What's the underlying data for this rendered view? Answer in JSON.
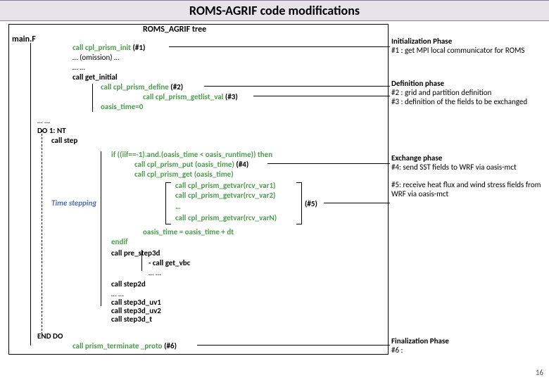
{
  "title": "ROMS-AGRIF code modifications",
  "tree_title": "ROMS_AGRIF tree",
  "mainF": "main.F",
  "code": {
    "init1": "call cpl_prism_init",
    "init1_tag": "(#1)",
    "omission": "… (omission) …",
    "dots1": "… …",
    "get_initial": "call get_initial",
    "define": "call cpl_prism_define",
    "define_tag": "(#2)",
    "getlist": "call cpl_prism_getlist_val",
    "getlist_tag": "(#3)",
    "oasis0": "oasis_time=0",
    "dots2": "… …",
    "do": "DO 1: NT",
    "call_step": "call step",
    "if": "if ((iif==-1).and.(oasis_time < oasis_runtime)) then",
    "put": "call cpl_prism_put (oasis_time)",
    "put_tag": "(#4)",
    "get": "call cpl_prism_get (oasis_time)",
    "getvar1": "call cpl_prism_getvar(rcv_var1)",
    "getvar2": "call cpl_prism_getvar(rcv_var2)",
    "getvar_dots": "…",
    "getvarN": "call cpl_prism_getvar(rcv_varN)",
    "getvar_tag": "(#5)",
    "oasis_dt": "oasis_time = oasis_time + dt",
    "endif": "endif",
    "pre_step3d": "call pre_step3d",
    "get_vbc": "- call get_vbc",
    "dots3": "… …",
    "step2d": "call step2d",
    "dots4": "… …",
    "step3d_uv1": "call step3d_uv1",
    "step3d_uv2": "call step3d_uv2",
    "step3d_t": "call step3d_t",
    "end_do": "END DO",
    "terminate": "call prism_terminate _proto",
    "terminate_tag": "(#6)",
    "time_stepping": "Time stepping"
  },
  "right": {
    "init_title": "Initialization Phase",
    "init_text": "#1 : get MPI local communicator for ROMS",
    "def_title": "Definition phase",
    "def_text1": "#2 : grid and partition definition",
    "def_text2": "#3 : definition of the fields to be exchanged",
    "ex_title": "Exchange phase",
    "ex_text1": "#4: send SST fields to WRF via oasis-mct",
    "ex_text2": "#5: receive heat flux and wind stress fields from WRF via oasis-mct",
    "fin_title": "Finalization Phase",
    "fin_text": "#6 :"
  },
  "page": "16"
}
